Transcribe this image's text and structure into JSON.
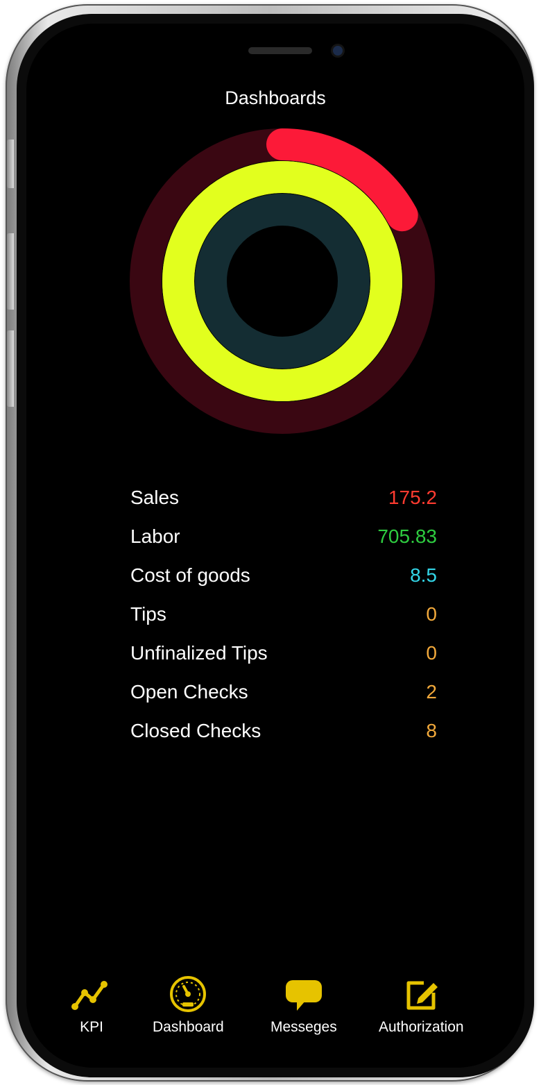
{
  "app": {
    "title": "Dashboards"
  },
  "rings": [
    {
      "name": "outer",
      "track_color": "#3a0712",
      "fill_color": "#fc1a38",
      "progress": 0.17
    },
    {
      "name": "middle",
      "track_color": "#c4ff00",
      "fill_color": "#e2ff1e",
      "progress": 1.0
    },
    {
      "name": "inner",
      "track_color": "#142d33",
      "fill_color": "#1ad3e6",
      "progress": 0.0
    }
  ],
  "stats": [
    {
      "label": "Sales",
      "value": "175.2",
      "color": "#ff3b30"
    },
    {
      "label": "Labor",
      "value": "705.83",
      "color": "#2ecc40"
    },
    {
      "label": "Cost of goods",
      "value": "8.5",
      "color": "#33d6e8"
    },
    {
      "label": "Tips",
      "value": "0",
      "color": "#f2a93b"
    },
    {
      "label": "Unfinalized Tips",
      "value": "0",
      "color": "#f2a93b"
    },
    {
      "label": "Open Checks",
      "value": "2",
      "color": "#f2a93b"
    },
    {
      "label": "Closed Checks",
      "value": "8",
      "color": "#f2a93b"
    }
  ],
  "tabs": [
    {
      "label": "KPI",
      "icon": "line-chart-icon"
    },
    {
      "label": "Dashboard",
      "icon": "speedometer-icon"
    },
    {
      "label": "Messeges",
      "icon": "chat-bubble-icon"
    },
    {
      "label": "Authorization",
      "icon": "edit-icon"
    }
  ],
  "colors": {
    "accent": "#e6c300",
    "background": "#000000"
  }
}
